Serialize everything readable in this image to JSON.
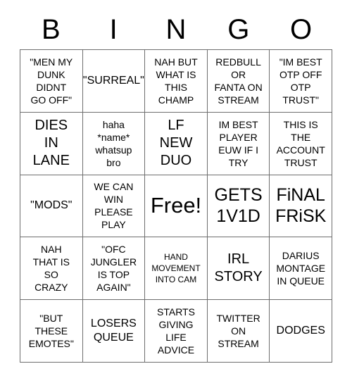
{
  "card": {
    "header_letters": [
      "B",
      "I",
      "N",
      "G",
      "O"
    ],
    "border_color": "#6e6e6e",
    "text_color": "#000000",
    "background_color": "#ffffff",
    "columns": 5,
    "rows": 5,
    "cells": [
      {
        "text": "\"MEN MY\nDUNK\nDIDNT\nGO OFF\"",
        "size": "s"
      },
      {
        "text": "\"SURREAL\"",
        "size": "m"
      },
      {
        "text": "NAH BUT\nWHAT IS\nTHIS\nCHAMP",
        "size": "s"
      },
      {
        "text": "REDBULL\nOR\nFANTA ON\nSTREAM",
        "size": "s"
      },
      {
        "text": "\"IM BEST\nOTP OFF\nOTP\nTRUST\"",
        "size": "s"
      },
      {
        "text": "DIES\nIN\nLANE",
        "size": "l"
      },
      {
        "text": "haha\n*name*\nwhatsup\nbro",
        "size": "s"
      },
      {
        "text": "LF\nNEW\nDUO",
        "size": "l"
      },
      {
        "text": "IM BEST\nPLAYER\nEUW IF I\nTRY",
        "size": "s"
      },
      {
        "text": "THIS IS\nTHE\nACCOUNT\nTRUST",
        "size": "s"
      },
      {
        "text": "\"MODS\"",
        "size": "m"
      },
      {
        "text": "WE CAN\nWIN\nPLEASE\nPLAY",
        "size": "s"
      },
      {
        "text": "Free!",
        "size": "free"
      },
      {
        "text": "GETS\n1V1D",
        "size": "xl"
      },
      {
        "text": "FiNAL\nFRiSK",
        "size": "xl"
      },
      {
        "text": "NAH\nTHAT IS\nSO\nCRAZY",
        "size": "s"
      },
      {
        "text": "\"OFC\nJUNGLER\nIS TOP\nAGAIN\"",
        "size": "s"
      },
      {
        "text": "HAND\nMOVEMENT\nINTO CAM",
        "size": "xs"
      },
      {
        "text": "IRL\nSTORY",
        "size": "l"
      },
      {
        "text": "DARIUS\nMONTAGE\nIN QUEUE",
        "size": "s"
      },
      {
        "text": "\"BUT\nTHESE\nEMOTES\"",
        "size": "s"
      },
      {
        "text": "LOSERS\nQUEUE",
        "size": "m"
      },
      {
        "text": "STARTS\nGIVING\nLIFE\nADVICE",
        "size": "s"
      },
      {
        "text": "TWITTER\nON\nSTREAM",
        "size": "s"
      },
      {
        "text": "DODGES",
        "size": "m"
      }
    ]
  }
}
